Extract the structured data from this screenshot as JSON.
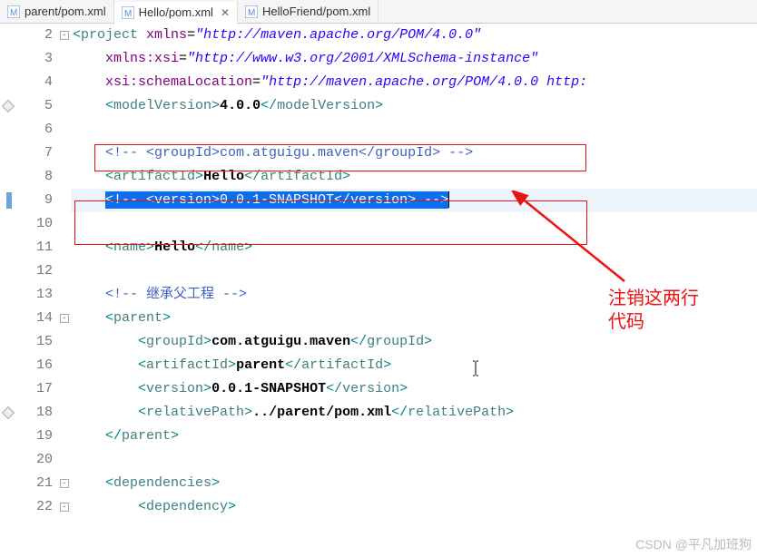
{
  "tabs": [
    {
      "label": "parent/pom.xml",
      "icon": "maven-file"
    },
    {
      "label": "Hello/pom.xml",
      "icon": "maven-file",
      "active": true
    },
    {
      "label": "HelloFriend/pom.xml",
      "icon": "maven-file"
    }
  ],
  "annotation": {
    "line1": "注销这两行",
    "line2": "代码"
  },
  "watermark": "CSDN @平凡加班狗",
  "code": {
    "lines": [
      {
        "n": "2",
        "fold": true,
        "segs": [
          {
            "cls": "p",
            "t": "<"
          },
          {
            "cls": "t",
            "t": "project"
          },
          {
            "cls": "txt",
            "t": " "
          },
          {
            "cls": "a",
            "t": "xmlns"
          },
          {
            "cls": "txt",
            "t": "="
          },
          {
            "cls": "v",
            "t": "\"http://maven.apache.org/POM/4.0.0\""
          }
        ]
      },
      {
        "n": "3",
        "segs": [
          {
            "cls": "txt",
            "t": "    "
          },
          {
            "cls": "a",
            "t": "xmlns:xsi"
          },
          {
            "cls": "txt",
            "t": "="
          },
          {
            "cls": "v",
            "t": "\"http://www.w3.org/2001/XMLSchema-instance\""
          }
        ]
      },
      {
        "n": "4",
        "segs": [
          {
            "cls": "txt",
            "t": "    "
          },
          {
            "cls": "a",
            "t": "xsi:schemaLocation"
          },
          {
            "cls": "txt",
            "t": "="
          },
          {
            "cls": "v",
            "t": "\"http://maven.apache.org/POM/4.0.0 http:"
          }
        ]
      },
      {
        "n": "5",
        "segs": [
          {
            "cls": "txt",
            "t": "    "
          },
          {
            "cls": "p",
            "t": "<"
          },
          {
            "cls": "t",
            "t": "modelVersion"
          },
          {
            "cls": "p",
            "t": ">"
          },
          {
            "cls": "k",
            "t": "4.0.0"
          },
          {
            "cls": "p",
            "t": "</"
          },
          {
            "cls": "t",
            "t": "modelVersion"
          },
          {
            "cls": "p",
            "t": ">"
          }
        ],
        "marker": "diamond"
      },
      {
        "n": "6",
        "segs": [
          {
            "cls": "txt",
            "t": ""
          }
        ]
      },
      {
        "n": "7",
        "segs": [
          {
            "cls": "txt",
            "t": "    "
          },
          {
            "cls": "c",
            "t": "<!-- <groupId>com.atguigu.maven</groupId> -->"
          }
        ]
      },
      {
        "n": "8",
        "segs": [
          {
            "cls": "txt",
            "t": "    "
          },
          {
            "cls": "p",
            "t": "<"
          },
          {
            "cls": "t",
            "t": "artifactId"
          },
          {
            "cls": "p",
            "t": ">"
          },
          {
            "cls": "k",
            "t": "Hello"
          },
          {
            "cls": "p",
            "t": "</"
          },
          {
            "cls": "t",
            "t": "artifactId"
          },
          {
            "cls": "p",
            "t": ">"
          }
        ]
      },
      {
        "n": "9",
        "current": true,
        "marker": "blue",
        "segs": [
          {
            "cls": "txt",
            "t": "    "
          },
          {
            "sel": true,
            "cls": "c",
            "t": "<!-- <version>0.0.1-SNAPSHOT</version> -->"
          }
        ]
      },
      {
        "n": "10",
        "segs": [
          {
            "cls": "txt",
            "t": ""
          }
        ]
      },
      {
        "n": "11",
        "segs": [
          {
            "cls": "txt",
            "t": "    "
          },
          {
            "cls": "p",
            "t": "<"
          },
          {
            "cls": "t",
            "t": "name"
          },
          {
            "cls": "p",
            "t": ">"
          },
          {
            "cls": "k",
            "t": "Hello"
          },
          {
            "cls": "p",
            "t": "</"
          },
          {
            "cls": "t",
            "t": "name"
          },
          {
            "cls": "p",
            "t": ">"
          }
        ]
      },
      {
        "n": "12",
        "segs": [
          {
            "cls": "txt",
            "t": ""
          }
        ]
      },
      {
        "n": "13",
        "segs": [
          {
            "cls": "txt",
            "t": "    "
          },
          {
            "cls": "c",
            "t": "<!-- 继承父工程 -->"
          }
        ]
      },
      {
        "n": "14",
        "fold": true,
        "segs": [
          {
            "cls": "txt",
            "t": "    "
          },
          {
            "cls": "p",
            "t": "<"
          },
          {
            "cls": "t",
            "t": "parent"
          },
          {
            "cls": "p",
            "t": ">"
          }
        ]
      },
      {
        "n": "15",
        "segs": [
          {
            "cls": "txt",
            "t": "        "
          },
          {
            "cls": "p",
            "t": "<"
          },
          {
            "cls": "t",
            "t": "groupId"
          },
          {
            "cls": "p",
            "t": ">"
          },
          {
            "cls": "k",
            "t": "com.atguigu.maven"
          },
          {
            "cls": "p",
            "t": "</"
          },
          {
            "cls": "t",
            "t": "grou"
          },
          {
            "cls": "txt",
            "t": ""
          },
          {
            "cls": "t",
            "t": "pId"
          },
          {
            "cls": "p",
            "t": ">"
          }
        ],
        "textcursor": 33
      },
      {
        "n": "16",
        "segs": [
          {
            "cls": "txt",
            "t": "        "
          },
          {
            "cls": "p",
            "t": "<"
          },
          {
            "cls": "t",
            "t": "artifactId"
          },
          {
            "cls": "p",
            "t": ">"
          },
          {
            "cls": "k",
            "t": "parent"
          },
          {
            "cls": "p",
            "t": "</"
          },
          {
            "cls": "t",
            "t": "artifactId"
          },
          {
            "cls": "p",
            "t": ">"
          }
        ]
      },
      {
        "n": "17",
        "segs": [
          {
            "cls": "txt",
            "t": "        "
          },
          {
            "cls": "p",
            "t": "<"
          },
          {
            "cls": "t",
            "t": "version"
          },
          {
            "cls": "p",
            "t": ">"
          },
          {
            "cls": "k",
            "t": "0.0.1-SNAPSHOT"
          },
          {
            "cls": "p",
            "t": "</"
          },
          {
            "cls": "t",
            "t": "version"
          },
          {
            "cls": "p",
            "t": ">"
          }
        ]
      },
      {
        "n": "18",
        "segs": [
          {
            "cls": "txt",
            "t": "        "
          },
          {
            "cls": "p",
            "t": "<"
          },
          {
            "cls": "t",
            "t": "relativePath"
          },
          {
            "cls": "p",
            "t": ">"
          },
          {
            "cls": "k",
            "t": "../parent/pom.xml"
          },
          {
            "cls": "p",
            "t": "</"
          },
          {
            "cls": "t",
            "t": "relativePath"
          },
          {
            "cls": "p",
            "t": ">"
          }
        ],
        "marker": "diamond"
      },
      {
        "n": "19",
        "segs": [
          {
            "cls": "txt",
            "t": "    "
          },
          {
            "cls": "p",
            "t": "</"
          },
          {
            "cls": "t",
            "t": "parent"
          },
          {
            "cls": "p",
            "t": ">"
          }
        ]
      },
      {
        "n": "20",
        "segs": [
          {
            "cls": "txt",
            "t": ""
          }
        ]
      },
      {
        "n": "21",
        "fold": true,
        "segs": [
          {
            "cls": "txt",
            "t": "    "
          },
          {
            "cls": "p",
            "t": "<"
          },
          {
            "cls": "t",
            "t": "dependencies"
          },
          {
            "cls": "p",
            "t": ">"
          }
        ]
      },
      {
        "n": "22",
        "fold": true,
        "segs": [
          {
            "cls": "txt",
            "t": "        "
          },
          {
            "cls": "p",
            "t": "<"
          },
          {
            "cls": "t",
            "t": "dependency"
          },
          {
            "cls": "p",
            "t": ">"
          }
        ]
      }
    ]
  }
}
